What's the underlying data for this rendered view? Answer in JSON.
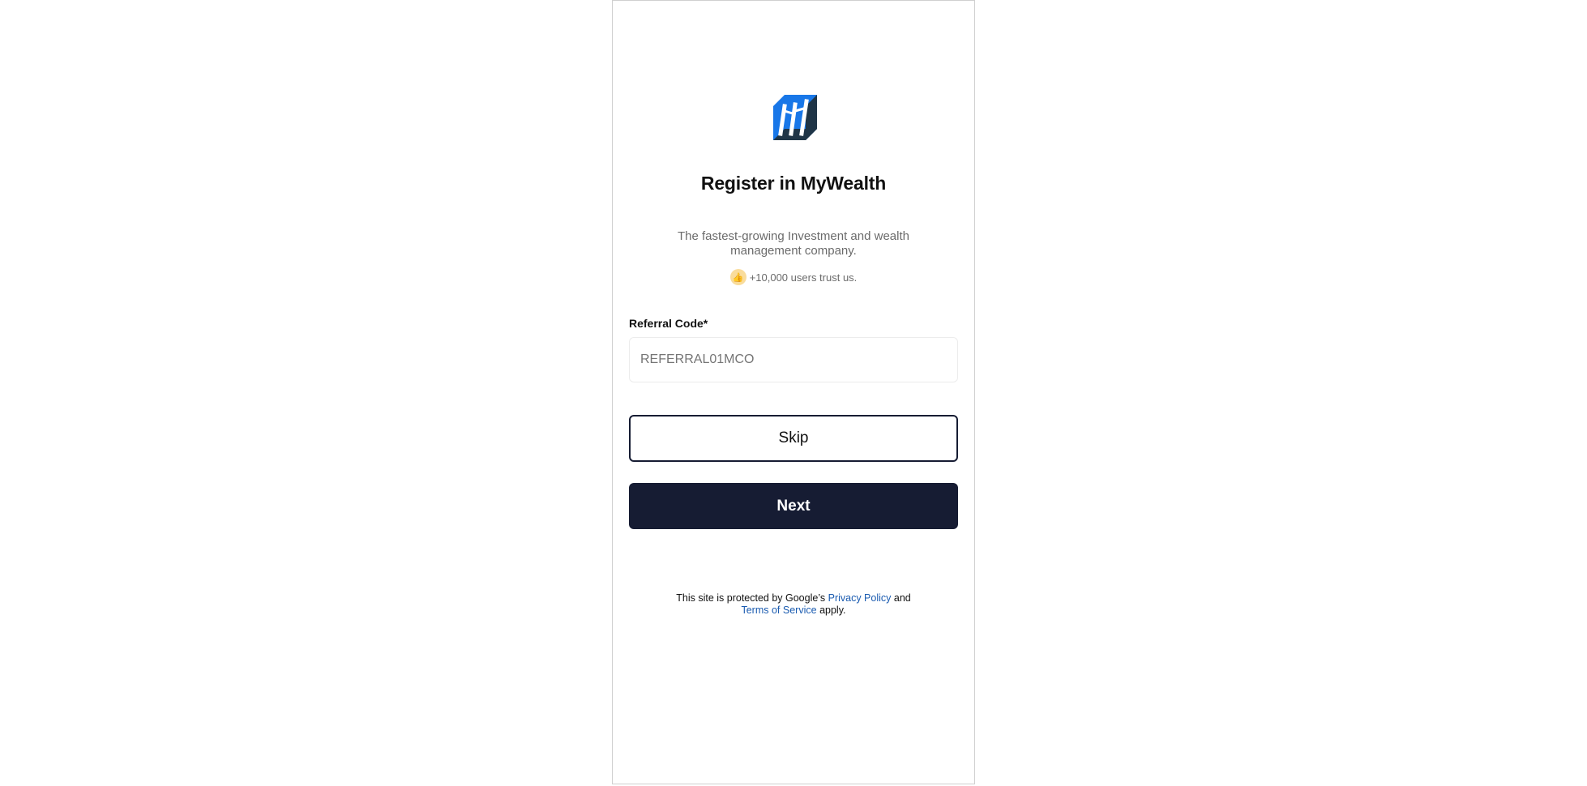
{
  "app": {
    "logo_icon": "mywealth-logo-icon",
    "accent_color": "#161c33",
    "link_color": "#1a5bb0"
  },
  "header": {
    "title": "Register in MyWealth",
    "subtitle": "The fastest-growing Investment and wealth management company.",
    "trust_icon": "thumbs-up-icon",
    "trust_text": "+10,000 users trust us."
  },
  "form": {
    "referral_label": "Referral Code*",
    "referral_placeholder": "REFERRAL01MCO",
    "referral_value": ""
  },
  "actions": {
    "skip_label": "Skip",
    "next_label": "Next"
  },
  "footer": {
    "prefix": "This site is protected by Google’s",
    "privacy_link": "Privacy Policy",
    "and": "and",
    "terms_link": "Terms of Service",
    "suffix": "apply."
  }
}
